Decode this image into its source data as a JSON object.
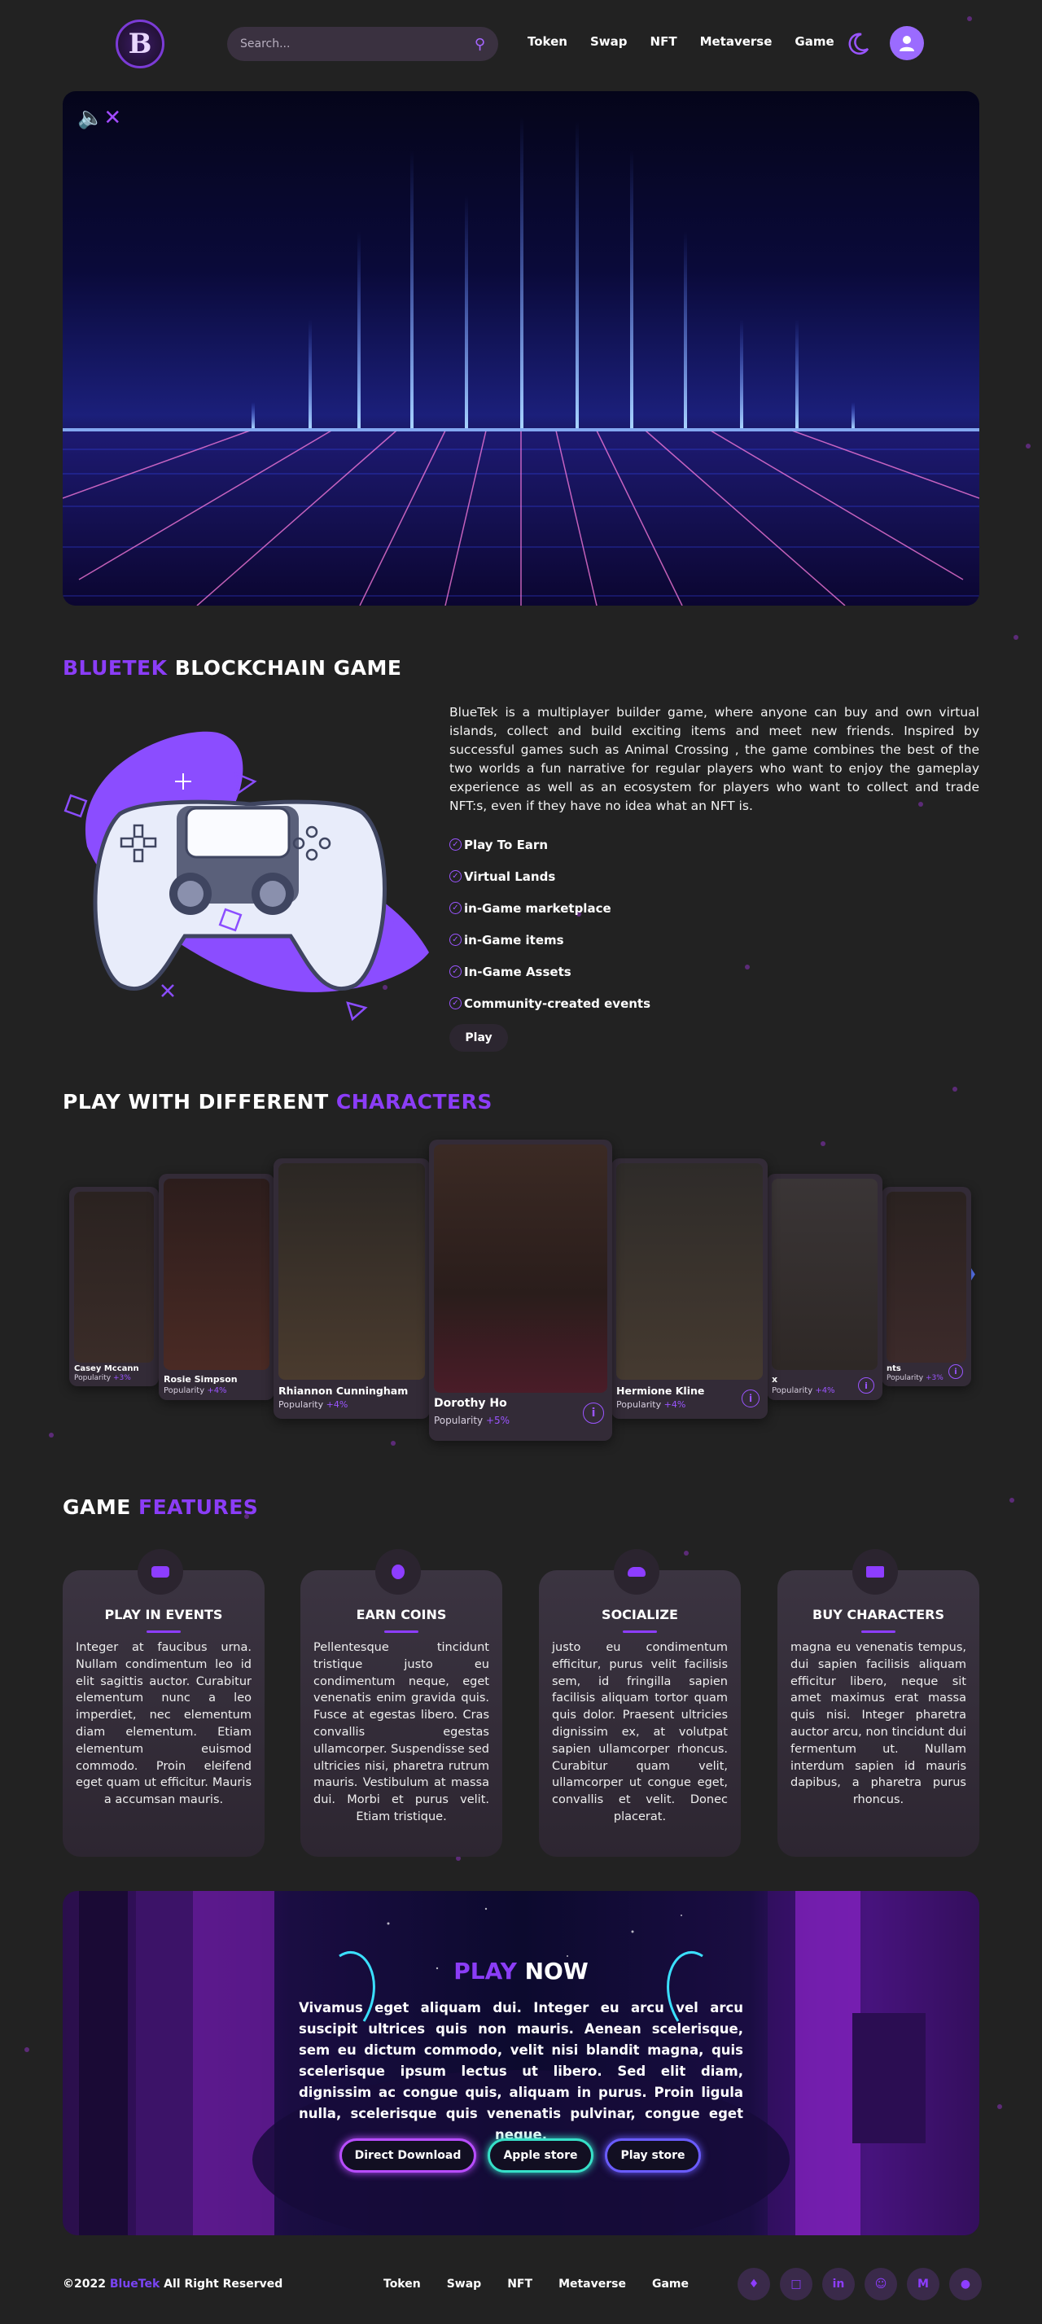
{
  "nav": {
    "logo_letter": "B",
    "search_placeholder": "Search...",
    "menu": [
      "Token",
      "Swap",
      "NFT",
      "Metaverse",
      "Game"
    ]
  },
  "about": {
    "title_accent": "BLUETEK",
    "title_rest": " BLOCKCHAIN GAME",
    "description": "BlueTek is a multiplayer builder game, where anyone can buy and own virtual islands, collect and build exciting items and meet new friends. Inspired by successful games such as Animal Crossing , the game combines the best of the two worlds a fun narrative for regular players who want to enjoy the gameplay experience as well as an ecosystem for players who want to collect and trade NFT:s, even if they have no idea what an NFT is.",
    "features": [
      "Play To Earn",
      "Virtual Lands",
      "in-Game marketplace",
      "in-Game items",
      "In-Game Assets",
      "Community-created events"
    ],
    "play_label": "Play"
  },
  "characters": {
    "title_rest": "PLAY WITH DIFFERENT ",
    "title_accent": "CHARACTERS",
    "popularity_label": "Popularity",
    "cards": [
      {
        "name": "Casey Mccann",
        "popularity": "+3%"
      },
      {
        "name": "Rosie Simpson",
        "popularity": "+4%"
      },
      {
        "name": "Rhiannon Cunningham",
        "popularity": "+4%"
      },
      {
        "name": "Dorothy Ho",
        "popularity": "+5%"
      },
      {
        "name": "Hermione Kline",
        "popularity": "+4%"
      },
      {
        "name": "x",
        "popularity": "+4%"
      },
      {
        "name": "nts",
        "popularity": "+3%"
      }
    ]
  },
  "game_features": {
    "title_rest": "GAME ",
    "title_accent": "FEATURES",
    "cards": [
      {
        "title": "PLAY IN EVENTS",
        "text": "Integer at faucibus urna. Nullam condimentum leo id elit sagittis auctor. Curabitur elementum nunc a leo imperdiet, nec elementum diam elementum. Etiam elementum euismod commodo. Proin eleifend eget quam ut efficitur. Mauris a accumsan mauris."
      },
      {
        "title": "EARN COINS",
        "text": "Pellentesque tincidunt tristique justo eu condimentum neque, eget venenatis enim gravida quis. Fusce at egestas libero. Cras convallis egestas ullamcorper. Suspendisse sed ultricies nisi, pharetra rutrum mauris. Vestibulum at massa dui. Morbi et purus velit. Etiam tristique."
      },
      {
        "title": "SOCIALIZE",
        "text": "justo eu condimentum efficitur, purus velit facilisis sem, id fringilla sapien facilisis aliquam tortor quam quis dolor. Praesent ultricies dignissim ex, at volutpat sapien ullamcorper rhoncus. Curabitur quam velit, ullamcorper ut congue eget, convallis et velit. Donec placerat."
      },
      {
        "title": "BUY CHARACTERS",
        "text": "magna eu venenatis tempus, dui sapien facilisis aliquam efficitur libero, neque sit amet maximus erat massa quis nisi. Integer pharetra auctor arcu, non tincidunt dui fermentum ut. Nullam interdum sapien id mauris dapibus, a pharetra purus rhoncus."
      }
    ]
  },
  "play_now": {
    "title_accent": "PLAY",
    "title_rest": " NOW",
    "text": "Vivamus eget aliquam dui. Integer eu arcu vel arcu suscipit ultrices quis non mauris. Aenean scelerisque, sem eu dictum commodo, velit nisi blandit magna, quis scelerisque ipsum lectus ut libero. Sed elit diam, dignissim ac congue quis, aliquam in purus. Proin ligula nulla, scelerisque quis venenatis pulvinar, congue eget neque.",
    "buttons": [
      "Direct Download",
      "Apple store",
      "Play store"
    ]
  },
  "footer": {
    "copyright_prefix": "©2022 ",
    "brand": "BlueTek",
    "copyright_suffix": " All Right Reserved",
    "menu": [
      "Token",
      "Swap",
      "NFT",
      "Metaverse",
      "Game"
    ],
    "social": [
      "twitter-icon",
      "instagram-icon",
      "linkedin-icon",
      "reddit-icon",
      "medium-icon",
      "coinmarketcap-icon"
    ]
  },
  "colors": {
    "accent": "#8b3df7",
    "background": "#222222"
  }
}
